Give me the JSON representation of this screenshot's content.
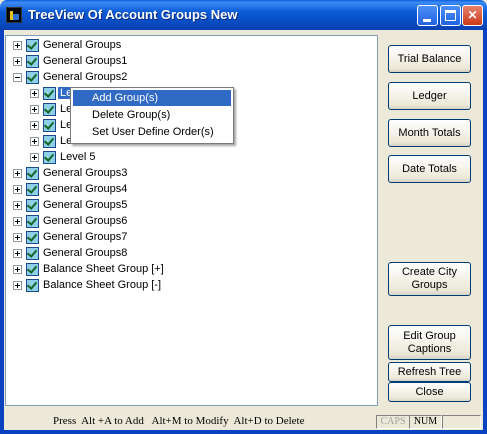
{
  "window": {
    "title": "TreeView Of Account Groups New",
    "controls": [
      "minimize-icon",
      "maximize-icon",
      "close-icon"
    ],
    "close_glyph": "✕"
  },
  "tree": {
    "nodes": [
      {
        "label": "General Groups",
        "expander": "+"
      },
      {
        "label": "General Groups1",
        "expander": "+"
      },
      {
        "label": "General Groups2",
        "expander": "-"
      },
      {
        "label": "Level 1",
        "visible_label": "Le",
        "expander": "+"
      },
      {
        "label": "Le",
        "expander": "+"
      },
      {
        "label": "Le",
        "expander": "+"
      },
      {
        "label": "Le",
        "expander": "+"
      },
      {
        "label": "Level 5",
        "expander": "+"
      },
      {
        "label": "General Groups3",
        "expander": "+"
      },
      {
        "label": "General Groups4",
        "expander": "+"
      },
      {
        "label": "General Groups5",
        "expander": "+"
      },
      {
        "label": "General Groups6",
        "expander": "+"
      },
      {
        "label": "General Groups7",
        "expander": "+"
      },
      {
        "label": "General Groups8",
        "expander": "+"
      },
      {
        "label": "Balance Sheet Group [+]",
        "expander": "+"
      },
      {
        "label": "Balance Sheet Group [-]",
        "expander": "+"
      }
    ]
  },
  "context_menu": {
    "items": [
      "Add Group(s)",
      "Delete Group(s)",
      "Set User Define Order(s)"
    ],
    "selected": "Add Group(s)"
  },
  "buttons": {
    "trial_balance": "Trial Balance",
    "ledger": "Ledger",
    "month_totals": "Month Totals",
    "date_totals": "Date Totals",
    "create_city_groups_1": "Create City",
    "create_city_groups_2": "Groups",
    "edit_group_captions_1": "Edit Group",
    "edit_group_captions_2": "Captions",
    "refresh_tree": "Refresh Tree",
    "close": "Close"
  },
  "status_bar": {
    "hint": "Press  Alt +A to Add   Alt+M to Modify  Alt+D to Delete",
    "caps": "CAPS",
    "num": "NUM",
    "caps_color": "#a0a0a0"
  }
}
